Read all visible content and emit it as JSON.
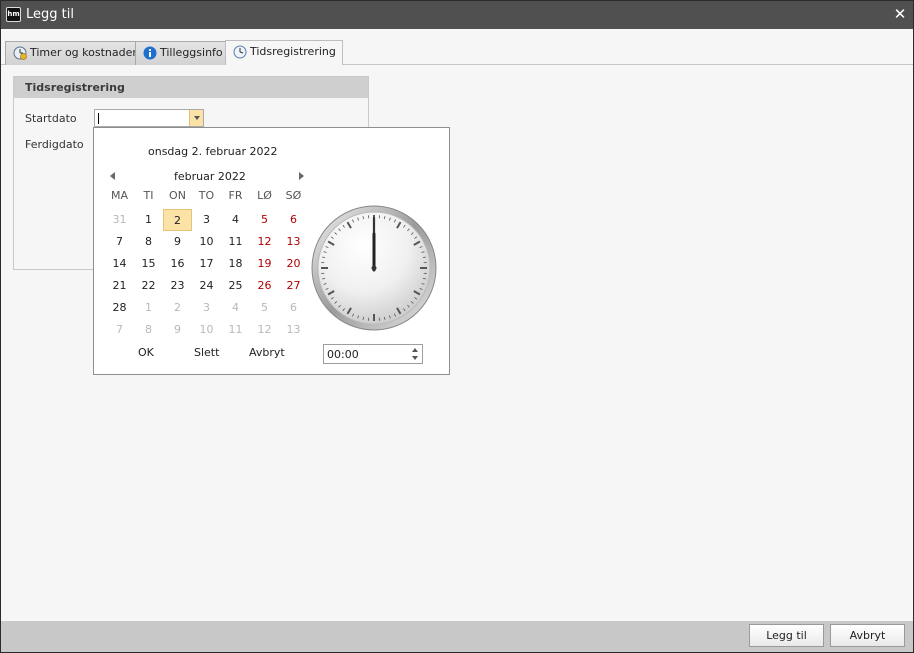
{
  "window": {
    "title": "Legg til"
  },
  "tabs": [
    {
      "label": "Timer og kostnader"
    },
    {
      "label": "Tilleggsinfo"
    },
    {
      "label": "Tidsregistrering"
    }
  ],
  "group": {
    "title": "Tidsregistrering",
    "start_label": "Startdato",
    "end_label": "Ferdigdato"
  },
  "calendar": {
    "today_label": "onsdag 2. februar 2022",
    "month_label": "februar 2022",
    "weekdays": [
      "MA",
      "TI",
      "ON",
      "TO",
      "FR",
      "LØ",
      "SØ"
    ],
    "weeks": [
      [
        "31",
        "1",
        "2",
        "3",
        "4",
        "5",
        "6"
      ],
      [
        "7",
        "8",
        "9",
        "10",
        "11",
        "12",
        "13"
      ],
      [
        "14",
        "15",
        "16",
        "17",
        "18",
        "19",
        "20"
      ],
      [
        "21",
        "22",
        "23",
        "24",
        "25",
        "26",
        "27"
      ],
      [
        "28",
        "1",
        "2",
        "3",
        "4",
        "5",
        "6"
      ],
      [
        "7",
        "8",
        "9",
        "10",
        "11",
        "12",
        "13"
      ]
    ],
    "ok_label": "OK",
    "clear_label": "Slett",
    "cancel_label": "Avbryt",
    "time_value": "00:00"
  },
  "footer": {
    "add_label": "Legg til",
    "cancel_label": "Avbryt"
  },
  "colors": {
    "accent": "#fbe3a7",
    "weekend": "#b00000",
    "titlebar": "#505050"
  }
}
